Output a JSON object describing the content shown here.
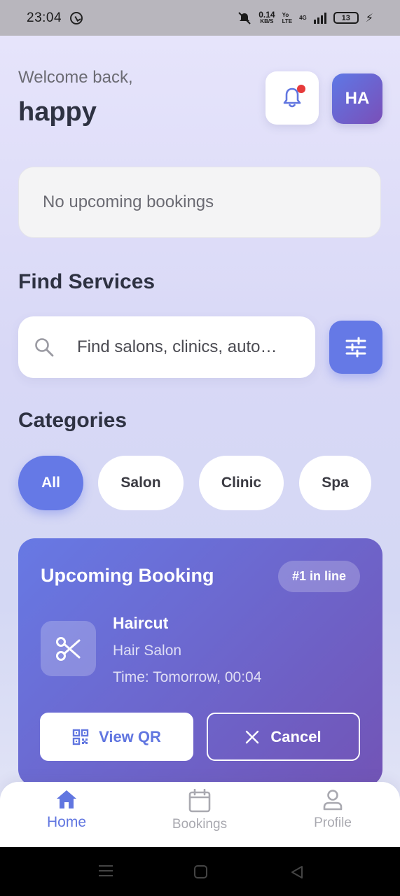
{
  "status_bar": {
    "time": "23:04",
    "net_speed_value": "0.14",
    "net_speed_unit": "KB/S",
    "volte_top": "Yo",
    "volte_bottom": "LTE",
    "network_type": "4G",
    "battery": "13"
  },
  "header": {
    "welcome": "Welcome back,",
    "username": "happy",
    "avatar_initials": "HA",
    "notification_icon": "bell-icon"
  },
  "bookings_summary": {
    "empty_text": "No upcoming bookings"
  },
  "find_services": {
    "title": "Find Services",
    "search_placeholder": "Find salons, clinics, auto…",
    "filter_icon": "sliders-icon"
  },
  "categories": {
    "title": "Categories",
    "items": [
      {
        "label": "All",
        "active": true
      },
      {
        "label": "Salon",
        "active": false
      },
      {
        "label": "Clinic",
        "active": false
      },
      {
        "label": "Spa",
        "active": false
      }
    ]
  },
  "upcoming_booking": {
    "title": "Upcoming Booking",
    "queue_badge": "#1 in line",
    "service_icon": "scissors-icon",
    "service_name": "Haircut",
    "place": "Hair Salon",
    "time": "Time: Tomorrow, 00:04",
    "view_qr_label": "View QR",
    "cancel_label": "Cancel"
  },
  "bottom_nav": {
    "items": [
      {
        "label": "Home",
        "icon": "home-icon",
        "active": true
      },
      {
        "label": "Bookings",
        "icon": "calendar-icon",
        "active": false
      },
      {
        "label": "Profile",
        "icon": "person-icon",
        "active": false
      }
    ]
  },
  "colors": {
    "accent": "#6579e6",
    "card_gradient_start": "#6779e4",
    "card_gradient_end": "#7254b6",
    "notification_dot": "#e63a3a",
    "heading": "#2e3242"
  }
}
